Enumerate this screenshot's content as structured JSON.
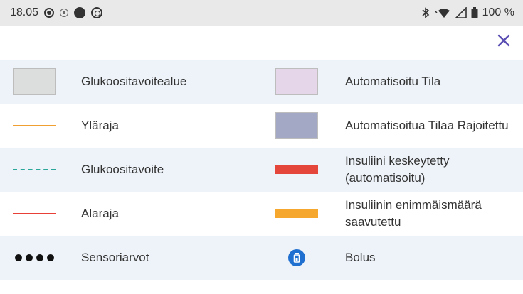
{
  "status_bar": {
    "time": "18.05",
    "battery": "100 %",
    "left_icons": [
      "record-icon",
      "info-ring-icon",
      "filled-circle-icon",
      "target-ring-icon"
    ],
    "right_icons": [
      "bluetooth-icon",
      "wifi-icon",
      "signal-icon",
      "battery-icon"
    ]
  },
  "header": {
    "close_icon": "close-icon"
  },
  "legend": {
    "rows": [
      {
        "left": {
          "label": "Glukoositavoitealue",
          "symbol": "box",
          "color": "#dcdedd"
        },
        "right": {
          "label": "Automatisoitu Tila",
          "symbol": "box",
          "color": "#e6d6ea"
        }
      },
      {
        "left": {
          "label": "Yläraja",
          "symbol": "line",
          "color": "#f0a030"
        },
        "right": {
          "label": "Automatisoitua Tilaa Rajoitettu",
          "symbol": "box",
          "color": "#a3a8c4"
        }
      },
      {
        "left": {
          "label": "Glukoositavoite",
          "symbol": "dashed-line",
          "color": "#2aa79a"
        },
        "right": {
          "label": "Insuliini keskeytetty (automatisoitu)",
          "symbol": "bar",
          "color": "#e4463c"
        }
      },
      {
        "left": {
          "label": "Alaraja",
          "symbol": "line",
          "color": "#e84036"
        },
        "right": {
          "label": "Insuliinin enimmäismäärä saavutettu",
          "symbol": "bar",
          "color": "#f5a72e"
        }
      },
      {
        "left": {
          "label": "Sensoriarvot",
          "symbol": "dots",
          "color": "#111111"
        },
        "right": {
          "label": "Bolus",
          "symbol": "bolus-icon",
          "color": "#1f6fd0"
        }
      }
    ]
  }
}
